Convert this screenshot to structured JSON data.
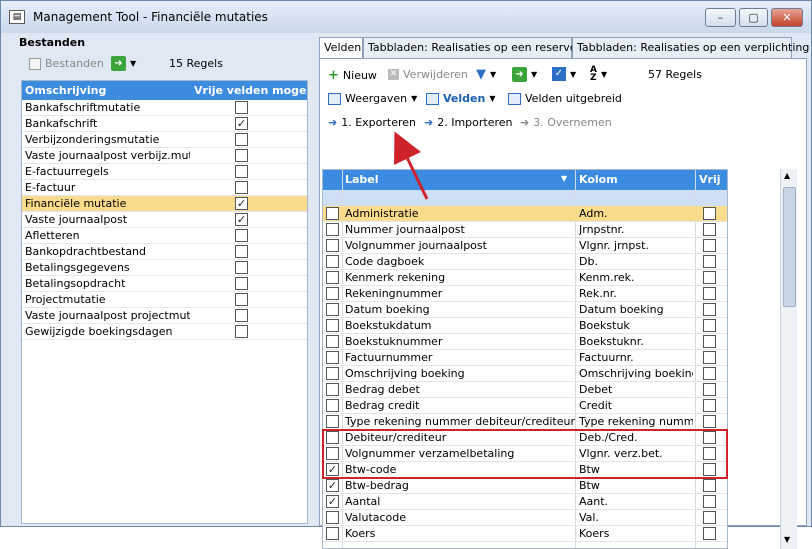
{
  "window": {
    "title": "Management Tool - Financiële mutaties",
    "icon": "app-icon",
    "min": "–",
    "max": "▢",
    "close": "✕"
  },
  "left": {
    "heading": "Bestanden",
    "files_btn": "Bestanden",
    "regels": "15 Regels",
    "columns": [
      "Omschrijving",
      "Vrije velden moge"
    ],
    "rows": [
      {
        "label": "Bankafschriftmutatie",
        "checked": false
      },
      {
        "label": "Bankafschrift",
        "checked": true
      },
      {
        "label": "Verbijzonderingsmutatie",
        "checked": false
      },
      {
        "label": "Vaste journaalpost verbijz.mutaties",
        "checked": false
      },
      {
        "label": "E-factuurregels",
        "checked": false
      },
      {
        "label": "E-factuur",
        "checked": false
      },
      {
        "label": "Financiële mutatie",
        "checked": true,
        "selected": true
      },
      {
        "label": "Vaste journaalpost",
        "checked": true
      },
      {
        "label": "Afletteren",
        "checked": false
      },
      {
        "label": "Bankopdrachtbestand",
        "checked": false
      },
      {
        "label": "Betalingsgegevens",
        "checked": false
      },
      {
        "label": "Betalingsopdracht",
        "checked": false
      },
      {
        "label": "Projectmutatie",
        "checked": false
      },
      {
        "label": "Vaste journaalpost projectmutaties",
        "checked": false
      },
      {
        "label": "Gewijzigde boekingsdagen",
        "checked": false
      }
    ]
  },
  "tabs": [
    "Velden",
    "Tabbladen: Realisaties op een reservering",
    "Tabbladen: Realisaties op een verplichting"
  ],
  "toolbar": {
    "nieuw": "Nieuw",
    "verwijderen": "Verwijderen",
    "regels": "57 Regels",
    "weergaven": "Weergaven",
    "velden": "Velden",
    "velden_uitgebreid": "Velden uitgebreid",
    "step1": "1. Exporteren",
    "step2": "2. Importeren",
    "step3": "3. Overnemen"
  },
  "grid": {
    "columns": [
      "Label",
      "Kolom",
      "Vrij"
    ],
    "rows": [
      {
        "label": "Administratie",
        "kolom": "Adm.",
        "sel": true,
        "checked": false,
        "vrij": false
      },
      {
        "label": "Nummer journaalpost",
        "kolom": "Jrnpstnr.",
        "checked": false,
        "vrij": false
      },
      {
        "label": "Volgnummer journaalpost",
        "kolom": "Vlgnr. jrnpst.",
        "checked": false,
        "vrij": false
      },
      {
        "label": "Code dagboek",
        "kolom": "Db.",
        "checked": false,
        "vrij": false
      },
      {
        "label": "Kenmerk rekening",
        "kolom": "Kenm.rek.",
        "checked": false,
        "vrij": false
      },
      {
        "label": "Rekeningnummer",
        "kolom": "Rek.nr.",
        "checked": false,
        "vrij": false
      },
      {
        "label": "Datum boeking",
        "kolom": "Datum boeking",
        "checked": false,
        "vrij": false
      },
      {
        "label": "Boekstukdatum",
        "kolom": "Boekstuk",
        "checked": false,
        "vrij": false
      },
      {
        "label": "Boekstuknummer",
        "kolom": "Boekstuknr.",
        "checked": false,
        "vrij": false
      },
      {
        "label": "Factuurnummer",
        "kolom": "Factuurnr.",
        "checked": false,
        "vrij": false
      },
      {
        "label": "Omschrijving boeking",
        "kolom": "Omschrijving boeking",
        "checked": false,
        "vrij": false
      },
      {
        "label": "Bedrag debet",
        "kolom": "Debet",
        "checked": false,
        "vrij": false
      },
      {
        "label": "Bedrag credit",
        "kolom": "Credit",
        "checked": false,
        "vrij": false
      },
      {
        "label": "Type rekening nummer debiteur/crediteur",
        "kolom": "Type rekening nummer d",
        "checked": false,
        "vrij": false
      },
      {
        "label": "Debiteur/crediteur",
        "kolom": "Deb./Cred.",
        "checked": false,
        "vrij": false
      },
      {
        "label": "Volgnummer verzamelbetaling",
        "kolom": "Vlgnr. verz.bet.",
        "checked": false,
        "vrij": false
      },
      {
        "label": "Btw-code",
        "kolom": "Btw",
        "checked": true,
        "vrij": false
      },
      {
        "label": "Btw-bedrag",
        "kolom": "Btw",
        "checked": true,
        "vrij": false
      },
      {
        "label": "Aantal",
        "kolom": "Aant.",
        "checked": true,
        "vrij": false
      },
      {
        "label": "Valutacode",
        "kolom": "Val.",
        "checked": false,
        "vrij": false
      },
      {
        "label": "Koers",
        "kolom": "Koers",
        "checked": false,
        "vrij": false
      }
    ]
  }
}
